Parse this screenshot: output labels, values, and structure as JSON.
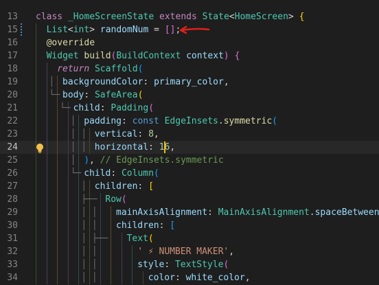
{
  "editor": {
    "current_line": "24",
    "lines": [
      {
        "num": "13",
        "segs": [
          [
            "k",
            "class"
          ],
          [
            "p",
            " "
          ],
          [
            "t",
            "_HomeScreenState"
          ],
          [
            "p",
            " "
          ],
          [
            "k",
            "extends"
          ],
          [
            "p",
            " "
          ],
          [
            "t",
            "State"
          ],
          [
            "p",
            "<"
          ],
          [
            "t",
            "HomeScreen"
          ],
          [
            "p",
            "> "
          ],
          [
            "bl",
            "{"
          ]
        ]
      },
      {
        "num": "15",
        "segs": [
          [
            "t",
            "List"
          ],
          [
            "p",
            "<"
          ],
          [
            "t",
            "int"
          ],
          [
            "p",
            "> "
          ],
          [
            "pr",
            "randomNum"
          ],
          [
            "p",
            " = "
          ],
          [
            "bp",
            "[]"
          ],
          [
            "p",
            ";"
          ]
        ]
      },
      {
        "num": "16",
        "segs": [
          [
            "an",
            "@override"
          ]
        ]
      },
      {
        "num": "17",
        "segs": [
          [
            "t",
            "Widget"
          ],
          [
            "p",
            " "
          ],
          [
            "f",
            "build"
          ],
          [
            "bp",
            "("
          ],
          [
            "t",
            "BuildContext"
          ],
          [
            "p",
            " "
          ],
          [
            "pr",
            "context"
          ],
          [
            "bp",
            ")"
          ],
          [
            "p",
            " "
          ],
          [
            "bp",
            "{"
          ]
        ]
      },
      {
        "num": "18",
        "segs": [
          [
            "ki",
            "return"
          ],
          [
            "p",
            " "
          ],
          [
            "t",
            "Scaffold"
          ],
          [
            "bb",
            "("
          ]
        ]
      },
      {
        "num": "19",
        "segs": [
          [
            "pr",
            "backgroundColor"
          ],
          [
            "p",
            ": "
          ],
          [
            "pr",
            "primary_color"
          ],
          [
            "p",
            ","
          ]
        ]
      },
      {
        "num": "20",
        "segs": [
          [
            "pr",
            "body"
          ],
          [
            "p",
            ": "
          ],
          [
            "t",
            "SafeArea"
          ],
          [
            "bl",
            "("
          ]
        ]
      },
      {
        "num": "21",
        "segs": [
          [
            "pr",
            "child"
          ],
          [
            "p",
            ": "
          ],
          [
            "t",
            "Padding"
          ],
          [
            "bp",
            "("
          ]
        ]
      },
      {
        "num": "22",
        "segs": [
          [
            "pr",
            "padding"
          ],
          [
            "p",
            ": "
          ],
          [
            "kb",
            "const"
          ],
          [
            "p",
            " "
          ],
          [
            "t",
            "EdgeInsets"
          ],
          [
            "p",
            "."
          ],
          [
            "f",
            "symmetric"
          ],
          [
            "bb",
            "("
          ]
        ]
      },
      {
        "num": "23",
        "segs": [
          [
            "pr",
            "vertical"
          ],
          [
            "p",
            ": "
          ],
          [
            "n",
            "8"
          ],
          [
            "p",
            ","
          ]
        ]
      },
      {
        "num": "24",
        "segs": [
          [
            "pr",
            "horizontal"
          ],
          [
            "p",
            ": "
          ],
          [
            "n",
            "16"
          ],
          [
            "p",
            ","
          ]
        ]
      },
      {
        "num": "25",
        "segs": [
          [
            "bb",
            ")"
          ],
          [
            "p",
            ", "
          ],
          [
            "cm",
            "// EdgeInsets.symmetric"
          ]
        ]
      },
      {
        "num": "26",
        "segs": [
          [
            "pr",
            "child"
          ],
          [
            "p",
            ": "
          ],
          [
            "t",
            "Column"
          ],
          [
            "bb",
            "("
          ]
        ]
      },
      {
        "num": "27",
        "segs": [
          [
            "pr",
            "children"
          ],
          [
            "p",
            ": "
          ],
          [
            "bl",
            "["
          ]
        ]
      },
      {
        "num": "28",
        "segs": [
          [
            "t",
            "Row"
          ],
          [
            "bp",
            "("
          ]
        ]
      },
      {
        "num": "29",
        "segs": [
          [
            "pr",
            "mainAxisAlignment"
          ],
          [
            "p",
            ": "
          ],
          [
            "t",
            "MainAxisAlignment"
          ],
          [
            "p",
            "."
          ],
          [
            "pr",
            "spaceBetween"
          ],
          [
            "p",
            ","
          ]
        ]
      },
      {
        "num": "30",
        "segs": [
          [
            "pr",
            "children"
          ],
          [
            "p",
            ": "
          ],
          [
            "bb",
            "["
          ]
        ]
      },
      {
        "num": "31",
        "segs": [
          [
            "t",
            "Text"
          ],
          [
            "bl",
            "("
          ]
        ]
      },
      {
        "num": "32",
        "segs": [
          [
            "s",
            "' ⚡ NUMBER MAKER'"
          ],
          [
            "p",
            ","
          ]
        ]
      },
      {
        "num": "33",
        "segs": [
          [
            "pr",
            "style"
          ],
          [
            "p",
            ": "
          ],
          [
            "t",
            "TextStyle"
          ],
          [
            "bp",
            "("
          ]
        ]
      },
      {
        "num": "34",
        "segs": [
          [
            "pr",
            "color"
          ],
          [
            "p",
            ": "
          ],
          [
            "pr",
            "white_color"
          ],
          [
            "p",
            ","
          ]
        ]
      }
    ]
  }
}
